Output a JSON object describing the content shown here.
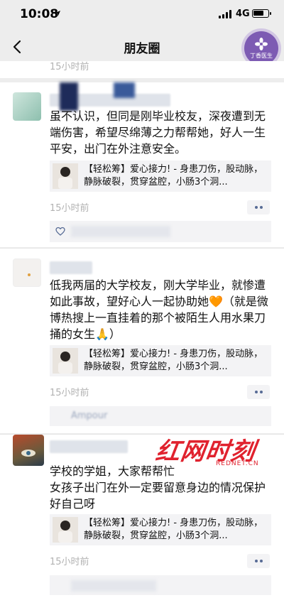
{
  "status": {
    "time": "10:08",
    "network": "4G"
  },
  "nav": {
    "title": "朋友圈"
  },
  "app_badge": {
    "label": "丁香医生"
  },
  "top_time": "15小时前",
  "posts": [
    {
      "text": "虽不认识，但同是刚毕业校友，深夜遭到无端伤害，希望尽绵薄之力帮帮她，好人一生平安，出门在外注意安全。",
      "link": "【轻松筹】爱心接力! - 身患刀伤，股动脉，静脉破裂，贯穿盆腔，小肠3个洞...",
      "time": "15小时前"
    },
    {
      "text": "低我两届的大学校友，刚大学毕业，就惨遭如此事故，望好心人一起协助她🧡（就是微博热搜上一直挂着的那个被陌生人用水果刀捅的女生🙏）",
      "link": "【轻松筹】爱心接力! - 身患刀伤，股动脉，静脉破裂，贯穿盆腔，小肠3个洞...",
      "time": "15小时前",
      "likes_name": "Ampour"
    },
    {
      "text": "学校的学姐，大家帮帮忙\n女孩子出门在外一定要留意身边的情况保护好自己呀",
      "link": "【轻松筹】爱心接力! - 身患刀伤，股动脉，静脉破裂，贯穿盆腔，小肠3个洞...",
      "time": "15小时前"
    }
  ],
  "watermark": {
    "text": "红网时刻",
    "sub": "REDNET.CN"
  },
  "icons": {
    "back": "chevron-left-icon",
    "more": "more-dots-icon",
    "like": "heart-outline-icon",
    "location": "location-arrow-icon",
    "battery": "battery-icon",
    "signal": "signal-bars-icon"
  }
}
